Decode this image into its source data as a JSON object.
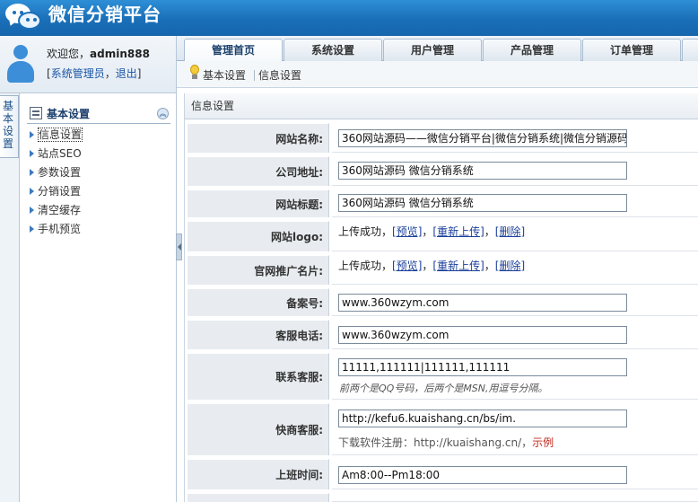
{
  "app": {
    "title": "微信分销平台"
  },
  "user": {
    "greeting": "欢迎您，",
    "name": "admin888",
    "role_open": "[",
    "role": "系统管理员",
    "sep": "，",
    "logout": "退出",
    "role_close": "]"
  },
  "tabs": [
    {
      "label": "管理首页",
      "active": true
    },
    {
      "label": "系统设置",
      "active": false
    },
    {
      "label": "用户管理",
      "active": false
    },
    {
      "label": "产品管理",
      "active": false
    },
    {
      "label": "订单管理",
      "active": false
    }
  ],
  "breadcrumb": {
    "parent": "基本设置",
    "current": "信息设置"
  },
  "sidebar": {
    "vertical_tab": "基本设置",
    "title": "基本设置",
    "collapse_icon": "double-chevron-up-icon",
    "items": [
      {
        "label": "信息设置",
        "active": true
      },
      {
        "label": "站点SEO",
        "active": false
      },
      {
        "label": "参数设置",
        "active": false
      },
      {
        "label": "分销设置",
        "active": false
      },
      {
        "label": "清空缓存",
        "active": false
      },
      {
        "label": "手机预览",
        "active": false
      }
    ]
  },
  "form": {
    "section_title": "信息设置",
    "site_name": {
      "label": "网站名称:",
      "value": "360网站源码——微信分销平台|微信分销系统|微信分销源码"
    },
    "company_address": {
      "label": "公司地址:",
      "value": "360网站源码 微信分销系统"
    },
    "site_title": {
      "label": "网站标题:",
      "value": "360网站源码 微信分销系统"
    },
    "logo": {
      "label": "网站logo:",
      "status": "上传成功，",
      "preview": "[预览]",
      "comma1": "，",
      "reupload": "[重新上传]",
      "comma2": "，",
      "delete": "[删除]"
    },
    "card": {
      "label": "官网推广名片:",
      "status": "上传成功，",
      "preview": "[预览]",
      "comma1": "，",
      "reupload": "[重新上传]",
      "comma2": "，",
      "delete": "[删除]"
    },
    "icp": {
      "label": "备案号:",
      "value": "www.360wzym.com"
    },
    "phone": {
      "label": "客服电话:",
      "value": "www.360wzym.com"
    },
    "contact": {
      "label": "联系客服:",
      "value": "11111,111111|111111,111111",
      "hint": "前两个是QQ号码，后两个是MSN,用逗号分隔。"
    },
    "kuaishang": {
      "label": "快商客服:",
      "value": "http://kefu6.kuaishang.cn/bs/im.",
      "note": "下载软件注册：http://kuaishang.cn/，",
      "example": "示例"
    },
    "hours": {
      "label": "上班时间:",
      "value": "Am8:00--Pm18:00"
    }
  },
  "colors": {
    "header": "#1a6fb8",
    "label_bg": "#e8ecf0",
    "link": "#1a3f9a",
    "example_red": "#c0281c"
  }
}
